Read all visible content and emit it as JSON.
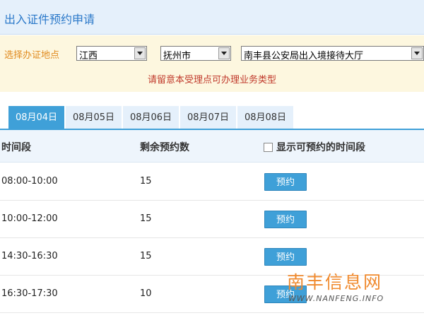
{
  "header": {
    "title": "出入证件预约申请"
  },
  "location": {
    "label": "选择办证地点",
    "province": "江西",
    "city": "抚州市",
    "office": "南丰县公安局出入境接待大厅",
    "notice": "请留意本受理点可办理业务类型"
  },
  "tabs": [
    {
      "label": "08月04日",
      "active": true
    },
    {
      "label": "08月05日",
      "active": false
    },
    {
      "label": "08月06日",
      "active": false
    },
    {
      "label": "08月07日",
      "active": false
    },
    {
      "label": "08月08日",
      "active": false
    }
  ],
  "table": {
    "headers": {
      "time": "时间段",
      "remaining": "剩余预约数",
      "show_available": "显示可预约的时间段"
    },
    "show_available_checked": false,
    "rows": [
      {
        "time": "08:00-10:00",
        "remaining": "15",
        "action": "预约"
      },
      {
        "time": "10:00-12:00",
        "remaining": "15",
        "action": "预约"
      },
      {
        "time": "14:30-16:30",
        "remaining": "15",
        "action": "预约"
      },
      {
        "time": "16:30-17:30",
        "remaining": "10",
        "action": "预约"
      }
    ]
  },
  "watermark": {
    "cn": "南丰信息网",
    "en": "WWW.NANFENG.INFO"
  },
  "colors": {
    "accent": "#3fa0d8",
    "title": "#2a78c9",
    "notice": "#c0392b",
    "label": "#e08a1e",
    "watermark": "#f08a2e"
  }
}
